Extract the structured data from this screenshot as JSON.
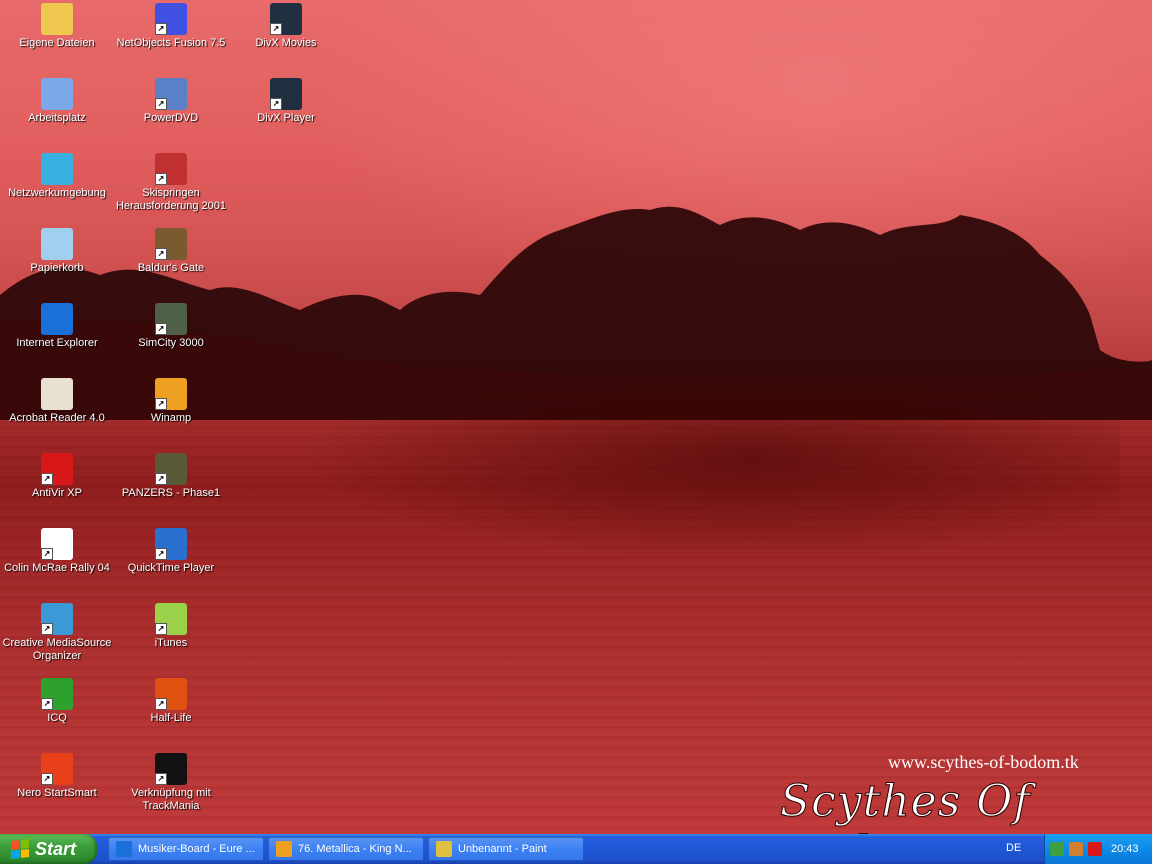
{
  "desktop": {
    "icons": [
      {
        "label": "Eigene Dateien",
        "icon": "folder-icon",
        "color": "#f0c850"
      },
      {
        "label": "Arbeitsplatz",
        "icon": "computer-icon",
        "color": "#7aa8e8"
      },
      {
        "label": "Netzwerkumgebung",
        "icon": "network-icon",
        "color": "#3ab0e0"
      },
      {
        "label": "Papierkorb",
        "icon": "recycle-bin-icon",
        "color": "#9fd0f0"
      },
      {
        "label": "Internet Explorer",
        "icon": "internet-explorer-icon",
        "color": "#1a70d8"
      },
      {
        "label": "Acrobat Reader 4.0",
        "icon": "acrobat-icon",
        "color": "#e8e0d0"
      },
      {
        "label": "AntiVir XP",
        "icon": "antivir-icon",
        "color": "#d81818"
      },
      {
        "label": "Colin McRae Rally 04",
        "icon": "rally-icon",
        "color": "#ffffff"
      },
      {
        "label": "Creative MediaSource Organizer",
        "icon": "mediasource-icon",
        "color": "#3a9ad8"
      },
      {
        "label": "ICQ",
        "icon": "icq-icon",
        "color": "#2ea02e"
      },
      {
        "label": "Nero StartSmart",
        "icon": "nero-icon",
        "color": "#e84018"
      },
      {
        "label": "NetObjects Fusion 7.5",
        "icon": "netobjects-icon",
        "color": "#4050e0"
      },
      {
        "label": "PowerDVD",
        "icon": "powerdvd-icon",
        "color": "#5a80c8"
      },
      {
        "label": "Skispringen Herausforderung 2001",
        "icon": "skispringen-icon",
        "color": "#c03030"
      },
      {
        "label": "Baldur's Gate",
        "icon": "baldurs-gate-icon",
        "color": "#7a5a30"
      },
      {
        "label": "SimCity 3000",
        "icon": "simcity-icon",
        "color": "#506048"
      },
      {
        "label": "Winamp",
        "icon": "winamp-icon",
        "color": "#f0a020"
      },
      {
        "label": "PANZERS - Phase1",
        "icon": "panzers-icon",
        "color": "#5a5a38"
      },
      {
        "label": "QuickTime Player",
        "icon": "quicktime-icon",
        "color": "#2a70d0"
      },
      {
        "label": "iTunes",
        "icon": "itunes-icon",
        "color": "#9ad04a"
      },
      {
        "label": "Half-Life",
        "icon": "half-life-icon",
        "color": "#e05010"
      },
      {
        "label": "Verknüpfung mit TrackMania",
        "icon": "trackmania-icon",
        "color": "#111111"
      },
      {
        "label": "DivX Movies",
        "icon": "divx-movies-icon",
        "color": "#203040"
      },
      {
        "label": "DivX Player",
        "icon": "divx-player-icon",
        "color": "#203040"
      }
    ],
    "watermark_url": "www.scythes-of-bodom.tk",
    "watermark_logo": "Scythes Of Bodom"
  },
  "taskbar": {
    "start_label": "Start",
    "tasks": [
      {
        "label": "Musiker-Board - Eure ...",
        "icon": "ie-icon",
        "color": "#1a70d8"
      },
      {
        "label": "76. Metallica - King N...",
        "icon": "winamp-icon",
        "color": "#f0a020"
      },
      {
        "label": "Unbenannt - Paint",
        "icon": "paint-icon",
        "color": "#e0c040"
      }
    ],
    "language": "DE",
    "tray_icons": [
      {
        "icon": "network-tray-icon",
        "color": "#40a040"
      },
      {
        "icon": "winamp-tray-icon",
        "color": "#d08030"
      },
      {
        "icon": "antivir-tray-icon",
        "color": "#d81818"
      }
    ],
    "clock": "20:43"
  }
}
